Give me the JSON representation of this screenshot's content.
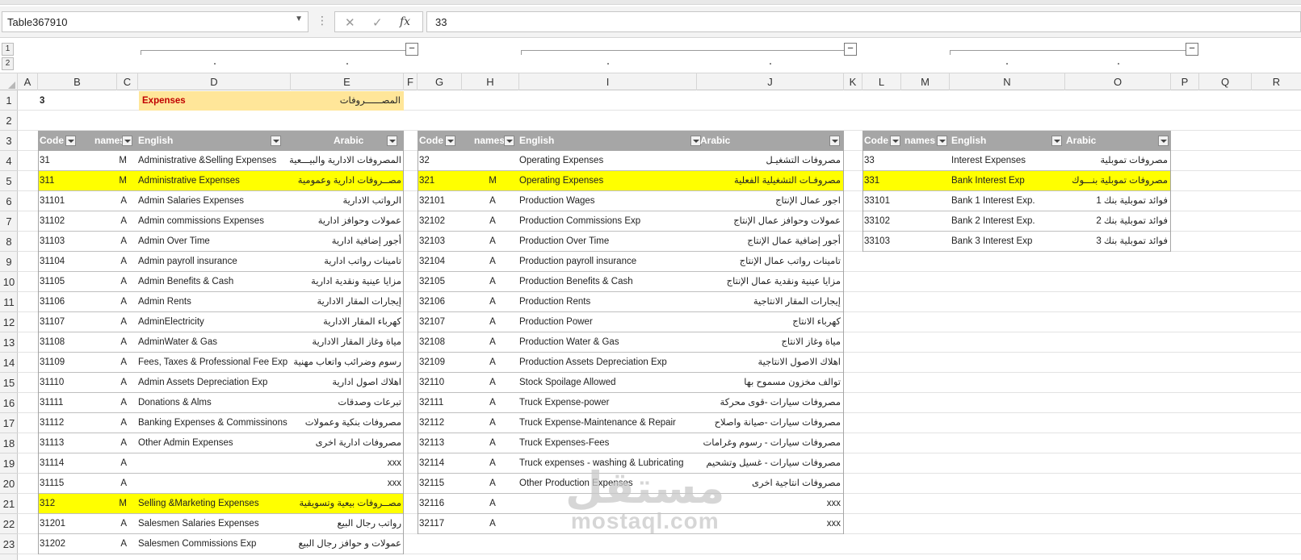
{
  "formula_bar": {
    "name_box": "Table367910",
    "formula": "33",
    "cancel_icon": "close-icon",
    "enter_icon": "check-icon",
    "fx_label": "fx"
  },
  "outline_levels": [
    "1",
    "2"
  ],
  "columns": [
    "A",
    "B",
    "C",
    "D",
    "E",
    "F",
    "G",
    "H",
    "I",
    "J",
    "K",
    "L",
    "M",
    "N",
    "O",
    "P",
    "Q",
    "R"
  ],
  "rows": [
    "1",
    "2",
    "3",
    "4",
    "5",
    "6",
    "7",
    "8",
    "9",
    "10",
    "11",
    "12",
    "13",
    "14",
    "15",
    "16",
    "17",
    "18",
    "19",
    "20",
    "21",
    "22",
    "23"
  ],
  "cells": {
    "b1": "3",
    "d1": "Expenses",
    "e1": "المصــــــروفات",
    "e1_fill": "#ffe699",
    "title_color": "#c00000"
  },
  "highlight_color": "#ffff00",
  "header_color": "#a6a6a6",
  "tables": {
    "admin": {
      "headers": [
        "Code",
        "names",
        "English",
        "Arabic"
      ],
      "rows": [
        {
          "code": "31",
          "name": "M",
          "en": "Administrative &Selling Expenses",
          "ar": "المصروفات الادارية والبيـــعية",
          "hl": false
        },
        {
          "code": "311",
          "name": "M",
          "en": "Administrative Expenses",
          "ar": "مصــروفات ادارية وعمومية",
          "hl": true
        },
        {
          "code": "31101",
          "name": "A",
          "en": "Admin Salaries Expenses",
          "ar": "الرواتب الادارية",
          "hl": false
        },
        {
          "code": "31102",
          "name": "A",
          "en": "Admin commissions Expenses",
          "ar": "عمولات وحوافز ادارية",
          "hl": false
        },
        {
          "code": "31103",
          "name": "A",
          "en": "Admin Over Time",
          "ar": "أجور إضافية ادارية",
          "hl": false
        },
        {
          "code": "31104",
          "name": "A",
          "en": "Admin payroll insurance",
          "ar": "تامينات رواتب ادارية",
          "hl": false
        },
        {
          "code": "31105",
          "name": "A",
          "en": "Admin Benefits & Cash",
          "ar": "مزايا عينية ونقدية ادارية",
          "hl": false
        },
        {
          "code": "31106",
          "name": "A",
          "en": "Admin Rents",
          "ar": "إيجارات المقار الادارية",
          "hl": false
        },
        {
          "code": "31107",
          "name": "A",
          "en": "AdminElectricity",
          "ar": "كهرباء المقار الادارية",
          "hl": false
        },
        {
          "code": "31108",
          "name": "A",
          "en": "AdminWater & Gas",
          "ar": "مياة وغاز المقار الادارية",
          "hl": false
        },
        {
          "code": "31109",
          "name": "A",
          "en": "Fees, Taxes & Professional Fee Exp",
          "ar": "رسوم وضرائب واتعاب مهنية",
          "hl": false
        },
        {
          "code": "31110",
          "name": "A",
          "en": "Admin Assets Depreciation Exp",
          "ar": "اهلاك اصول ادارية",
          "hl": false
        },
        {
          "code": "31111",
          "name": "A",
          "en": "Donations & Alms",
          "ar": "تبرعات وصدقات",
          "hl": false
        },
        {
          "code": "31112",
          "name": "A",
          "en": "Banking Expenses & Commissinons",
          "ar": "مصروفات بنكية وعمولات",
          "hl": false
        },
        {
          "code": "31113",
          "name": "A",
          "en": "Other Admin Expenses",
          "ar": "مصروفات ادارية اخرى",
          "hl": false
        },
        {
          "code": "31114",
          "name": "A",
          "en": "",
          "ar": "xxx",
          "hl": false
        },
        {
          "code": "31115",
          "name": "A",
          "en": "",
          "ar": "xxx",
          "hl": false
        },
        {
          "code": "312",
          "name": "M",
          "en": "Selling &Marketing Expenses",
          "ar": "مصــروفات بيعية وتسويقية",
          "hl": true
        },
        {
          "code": "31201",
          "name": "A",
          "en": "Salesmen Salaries Expenses",
          "ar": "رواتب رجال البيع",
          "hl": false
        },
        {
          "code": "31202",
          "name": "A",
          "en": "Salesmen Commissions  Exp",
          "ar": "عمولات و حوافز رجال البيع",
          "hl": false
        }
      ]
    },
    "operating": {
      "headers": [
        "Code",
        "names",
        "English",
        "Arabic"
      ],
      "rows": [
        {
          "code": "32",
          "name": "",
          "en": "Operating Expenses",
          "ar": "مصروفات التشغيـل",
          "hl": false
        },
        {
          "code": "321",
          "name": "M",
          "en": "Operating Expenses",
          "ar": "مصروفـات التشغيلية الفعلية",
          "hl": true
        },
        {
          "code": "32101",
          "name": "A",
          "en": "Production Wages",
          "ar": "اجور عمال الإنتاج",
          "hl": false
        },
        {
          "code": "32102",
          "name": "A",
          "en": "Production Commissions Exp",
          "ar": "عمولات وحوافز عمال الإنتاج",
          "hl": false
        },
        {
          "code": "32103",
          "name": "A",
          "en": "Production Over Time",
          "ar": "أجور إضافية عمال الإنتاج",
          "hl": false
        },
        {
          "code": "32104",
          "name": "A",
          "en": "Production payroll insurance",
          "ar": "تامينات رواتب عمال الإنتاج",
          "hl": false
        },
        {
          "code": "32105",
          "name": "A",
          "en": "Production Benefits & Cash",
          "ar": "مزايا عينية ونقدية عمال الإنتاج",
          "hl": false
        },
        {
          "code": "32106",
          "name": "A",
          "en": "Production Rents",
          "ar": "إيجارات المقار الانتاجية",
          "hl": false
        },
        {
          "code": "32107",
          "name": "A",
          "en": "Production Power",
          "ar": "كهرباء الانتاج",
          "hl": false
        },
        {
          "code": "32108",
          "name": "A",
          "en": "Production Water & Gas",
          "ar": "مياة وغاز الانتاج",
          "hl": false
        },
        {
          "code": "32109",
          "name": "A",
          "en": "Production Assets Depreciation Exp",
          "ar": "اهلاك الاصول الانتاجية",
          "hl": false
        },
        {
          "code": "32110",
          "name": "A",
          "en": "Stock Spoilage Allowed",
          "ar": "توالف مخزون مسموح بها",
          "hl": false
        },
        {
          "code": "32111",
          "name": "A",
          "en": "Truck Expense-power",
          "ar": "مصروفات سيارات -قوى محركة",
          "hl": false
        },
        {
          "code": "32112",
          "name": "A",
          "en": "Truck Expense-Maintenance & Repair",
          "ar": "مصروفات سيارات -صيانة واصلاح",
          "hl": false
        },
        {
          "code": "32113",
          "name": "A",
          "en": "Truck Expenses-Fees",
          "ar": "مصروفات سيارات - رسوم وغرامات",
          "hl": false
        },
        {
          "code": "32114",
          "name": "A",
          "en": "Truck  expenses - washing & Lubricating",
          "ar": "مصروفات سيارات - غسيل وتشحيم",
          "hl": false
        },
        {
          "code": "32115",
          "name": "A",
          "en": "Other Production  Expenses",
          "ar": "مصروفات انتاجية اخرى",
          "hl": false
        },
        {
          "code": "32116",
          "name": "A",
          "en": "",
          "ar": "xxx",
          "hl": false
        },
        {
          "code": "32117",
          "name": "A",
          "en": "",
          "ar": "xxx",
          "hl": false
        }
      ]
    },
    "interest": {
      "headers": [
        "Code",
        "names",
        "English",
        "Arabic"
      ],
      "rows": [
        {
          "code": "33",
          "name": "",
          "en": "Interest Expenses",
          "ar": "مصروفات تموبلية",
          "hl": false
        },
        {
          "code": "331",
          "name": "",
          "en": "Bank Interest Exp",
          "ar": "مصروفات تموبلية بنـــوك",
          "hl": true
        },
        {
          "code": "33101",
          "name": "",
          "en": "Bank 1 Interest Exp.",
          "ar": "فوائد تموبلية بنك 1",
          "hl": false
        },
        {
          "code": "33102",
          "name": "",
          "en": "Bank 2 Interest Exp.",
          "ar": "فوائد تموبلية بنك 2",
          "hl": false
        },
        {
          "code": "33103",
          "name": "",
          "en": "Bank 3 Interest Exp",
          "ar": "فوائد تموبلية بنك 3",
          "hl": false
        }
      ]
    }
  },
  "watermark": {
    "arabic": "مستقل",
    "latin": "mostaql.com"
  }
}
